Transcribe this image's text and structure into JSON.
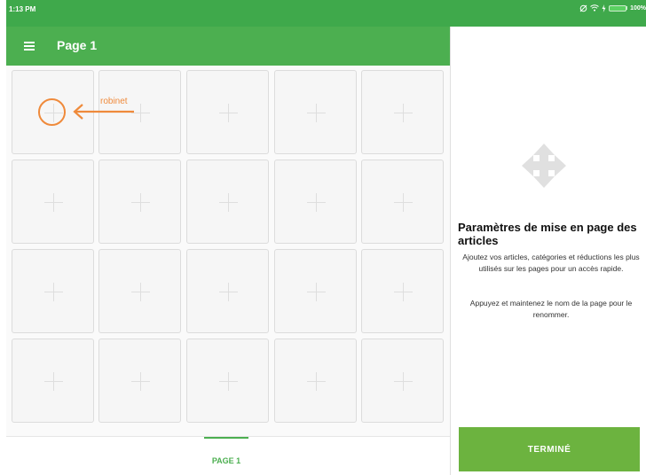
{
  "status_bar": {
    "time": "1:13 PM",
    "battery_level": "100%",
    "icons": [
      "mute-icon",
      "wifi-icon",
      "charging-icon",
      "battery-icon"
    ]
  },
  "toolbar": {
    "menu_icon": "hamburger-menu-icon",
    "title": "Page 1"
  },
  "grid": {
    "rows": 4,
    "columns": 5,
    "tile_icon": "plus-icon"
  },
  "annotation": {
    "label": "robinet",
    "color": "#ef8a3b"
  },
  "tabs": [
    {
      "label": "PAGE 1",
      "selected": true
    }
  ],
  "panel": {
    "icon": "move-arrows-icon",
    "title": "Paramètres de mise en page des articles",
    "paragraph_1": "Ajoutez vos articles, catégories et réductions les plus utilisés sur les pages pour un accès rapide.",
    "paragraph_2": "Appuyez et maintenez le nom de la page pour le renommer.",
    "done_label": "TERMINÉ"
  },
  "colors": {
    "status_bar": "#3fa94b",
    "toolbar": "#4caf50",
    "accent": "#4caf50",
    "done_button": "#6cb33f"
  }
}
